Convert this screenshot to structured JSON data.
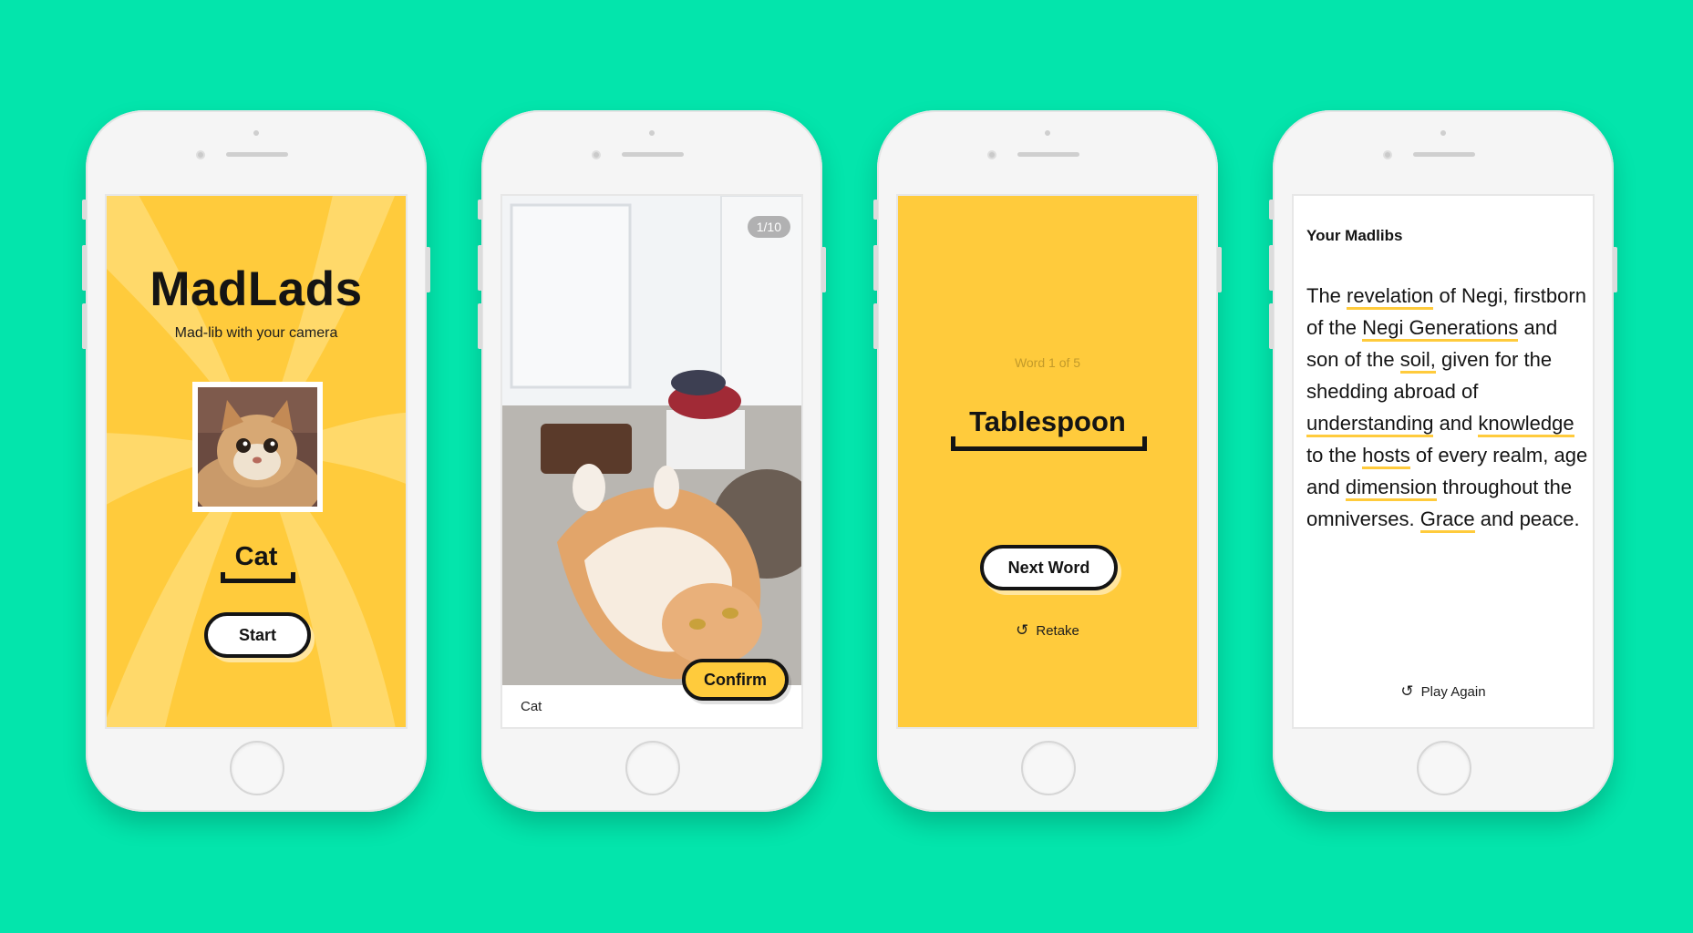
{
  "screen1": {
    "title": "MadLads",
    "subtitle": "Mad-lib with your camera",
    "word": "Cat",
    "start_label": "Start"
  },
  "screen2": {
    "counter": "1/10",
    "caption": "Cat",
    "confirm_label": "Confirm"
  },
  "screen3": {
    "word_count": "Word 1 of 5",
    "word": "Tablespoon",
    "next_label": "Next Word",
    "retake_label": "Retake"
  },
  "screen4": {
    "heading": "Your Madlibs",
    "story": [
      {
        "t": "The ",
        "u": false
      },
      {
        "t": "revelation",
        "u": true
      },
      {
        "t": " of Negi, firstborn of the ",
        "u": false
      },
      {
        "t": "Negi Generations",
        "u": true
      },
      {
        "t": " and son of the ",
        "u": false
      },
      {
        "t": "soil,",
        "u": true
      },
      {
        "t": " given for the shedding abroad of ",
        "u": false
      },
      {
        "t": "understanding",
        "u": true
      },
      {
        "t": " and ",
        "u": false
      },
      {
        "t": "knowledge",
        "u": true
      },
      {
        "t": " to the ",
        "u": false
      },
      {
        "t": "hosts",
        "u": true
      },
      {
        "t": " of every realm, age  and ",
        "u": false
      },
      {
        "t": "dimension",
        "u": true
      },
      {
        "t": " throughout the omniverses. ",
        "u": false
      },
      {
        "t": "Grace",
        "u": true
      },
      {
        "t": " and peace.",
        "u": false
      }
    ],
    "play_again_label": "Play Again"
  },
  "colors": {
    "background": "#03e5ac",
    "accent_yellow": "#ffcb3c",
    "ink": "#141414"
  },
  "icons": [
    "retake-icon",
    "play-again-icon"
  ]
}
